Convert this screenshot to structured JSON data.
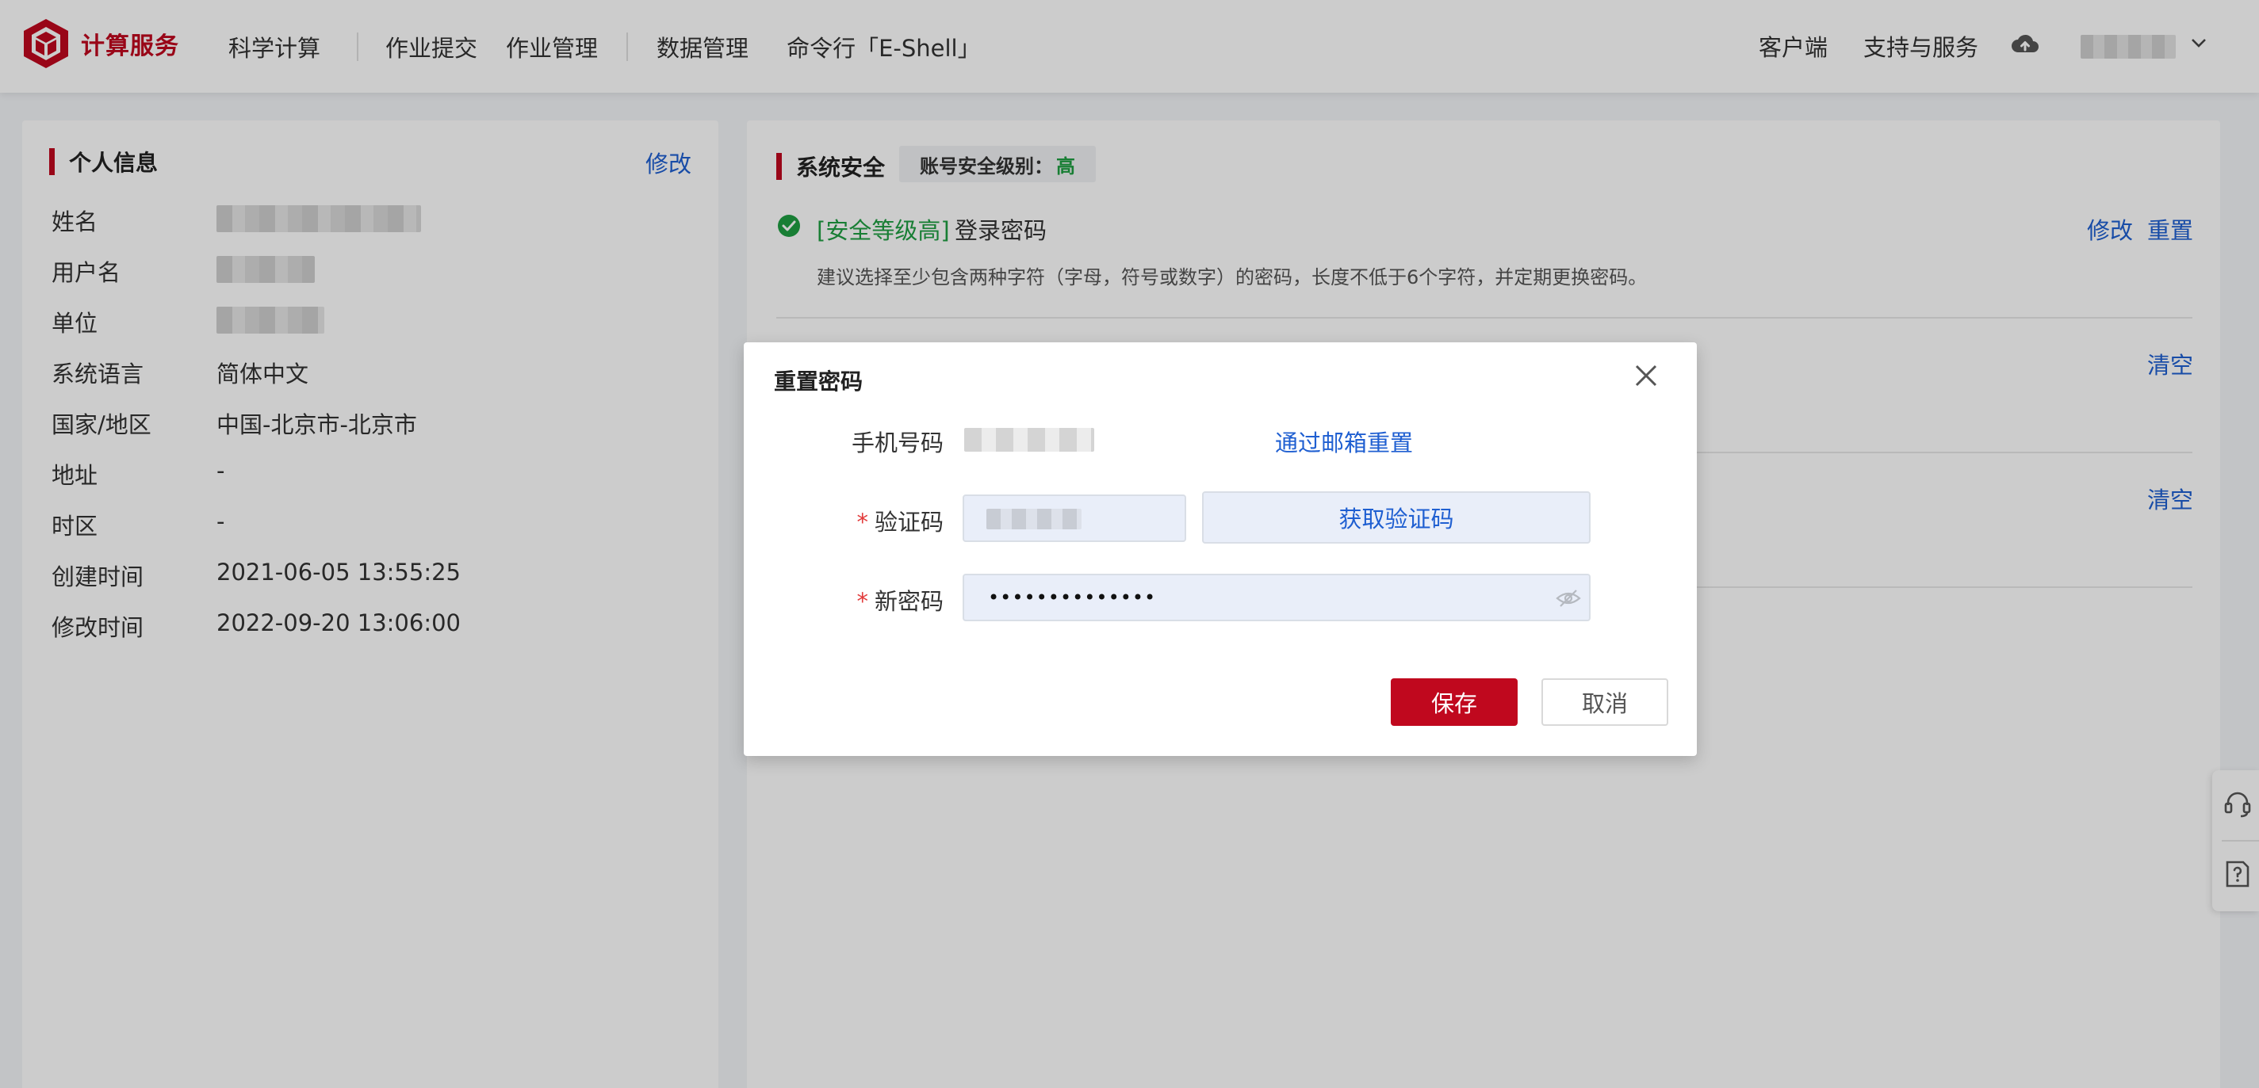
{
  "brand": {
    "name": "计算服务",
    "color": "#c0081e"
  },
  "nav": {
    "items": [
      "科学计算",
      "作业提交",
      "作业管理",
      "数据管理",
      "命令行「E-Shell」"
    ]
  },
  "header_right": {
    "client": "客户端",
    "support": "支持与服务",
    "upload_icon": "cloud-upload-icon",
    "user_dropdown_icon": "chevron-down-icon"
  },
  "personal_info": {
    "title": "个人信息",
    "edit_label": "修改",
    "fields": {
      "name_label": "姓名",
      "username_label": "用户名",
      "org_label": "单位",
      "language_label": "系统语言",
      "language_value": "简体中文",
      "region_label": "国家/地区",
      "region_value": "中国-北京市-北京市",
      "address_label": "地址",
      "address_value": "-",
      "timezone_label": "时区",
      "timezone_value": "-",
      "created_label": "创建时间",
      "created_value": "2021-06-05 13:55:25",
      "modified_label": "修改时间",
      "modified_value": "2022-09-20 13:06:00"
    }
  },
  "security": {
    "title": "系统安全",
    "level_label": "账号安全级别：",
    "level_value": "高",
    "password": {
      "level_tag": "[安全等级高]",
      "name": "登录密码",
      "hint": "建议选择至少包含两种字符（字母，符号或数字）的密码，长度不低于6个字符，并定期更换密码。",
      "edit_label": "修改",
      "reset_label": "重置"
    },
    "clear_label_1": "清空",
    "clear_label_2": "清空",
    "accent_green": "#1e9e42"
  },
  "modal": {
    "title": "重置密码",
    "phone_label": "手机号码",
    "email_reset_link": "通过邮箱重置",
    "code_label": "验证码",
    "get_code_button": "获取验证码",
    "new_password_label": "新密码",
    "new_password_value": "••••••••••••••",
    "required_mark": "*",
    "save_button": "保存",
    "cancel_button": "取消"
  },
  "side_tools": {
    "support_icon": "headset-icon",
    "help_icon": "help-document-icon"
  }
}
